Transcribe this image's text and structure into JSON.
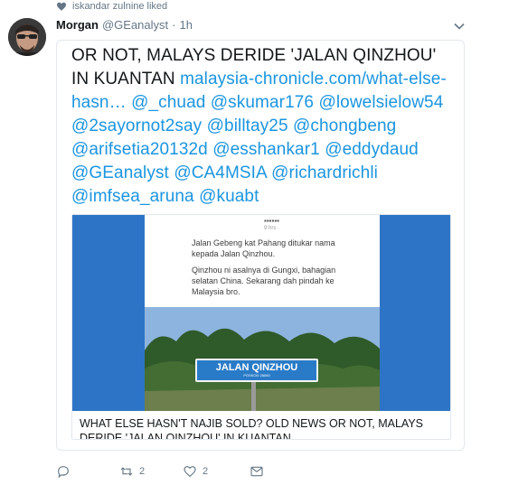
{
  "liked_line": {
    "icon": "heart-icon",
    "text": "iskandar zulnine liked"
  },
  "tweet": {
    "author_name": "Morgan",
    "handle": "@GEanalyst",
    "separator": "·",
    "time": "1h",
    "text_plain": "OR NOT, MALAYS DERIDE 'JALAN QINZHOU' IN KUANTAN",
    "link": "malaysia-chronicle.com/what-else-hasn…",
    "mentions_line": "@_chuad @skumar176 @lowelsielow54 @2sayornot2say @billtay25 @chongbeng @arifsetia20132d @esshankar1 @eddydaud @GEanalyst @CA4MSIA @richardrichli @imfsea_aruna @kuabt"
  },
  "card": {
    "fb_lines": [
      "Jalan Gebeng kat Pahang ditukar nama",
      "kepada Jalan Qinzhou.",
      "Qinzhou ni asalnya di Gungxi, bahagian",
      "selatan China. Sekarang dah pindah ke",
      "Malaysia bro."
    ],
    "fb_meta": "9 hrs ·",
    "sign_text": "JALAN QINZHOU",
    "sign_sub": "POSKOD 26080",
    "caption": "WHAT ELSE HASN'T NAJIB SOLD? OLD NEWS OR NOT, MALAYS DERIDE 'JALAN QINZHOU' IN KUANTAN"
  },
  "actions": {
    "reply_icon": "reply-icon",
    "retweet_icon": "retweet-icon",
    "retweet_count": "2",
    "like_icon": "like-icon",
    "like_count": "2",
    "dm_icon": "direct-message-icon"
  },
  "colors": {
    "link": "#1b95e0",
    "muted": "#657786",
    "text": "#14171a",
    "border": "#e1e8ed"
  }
}
